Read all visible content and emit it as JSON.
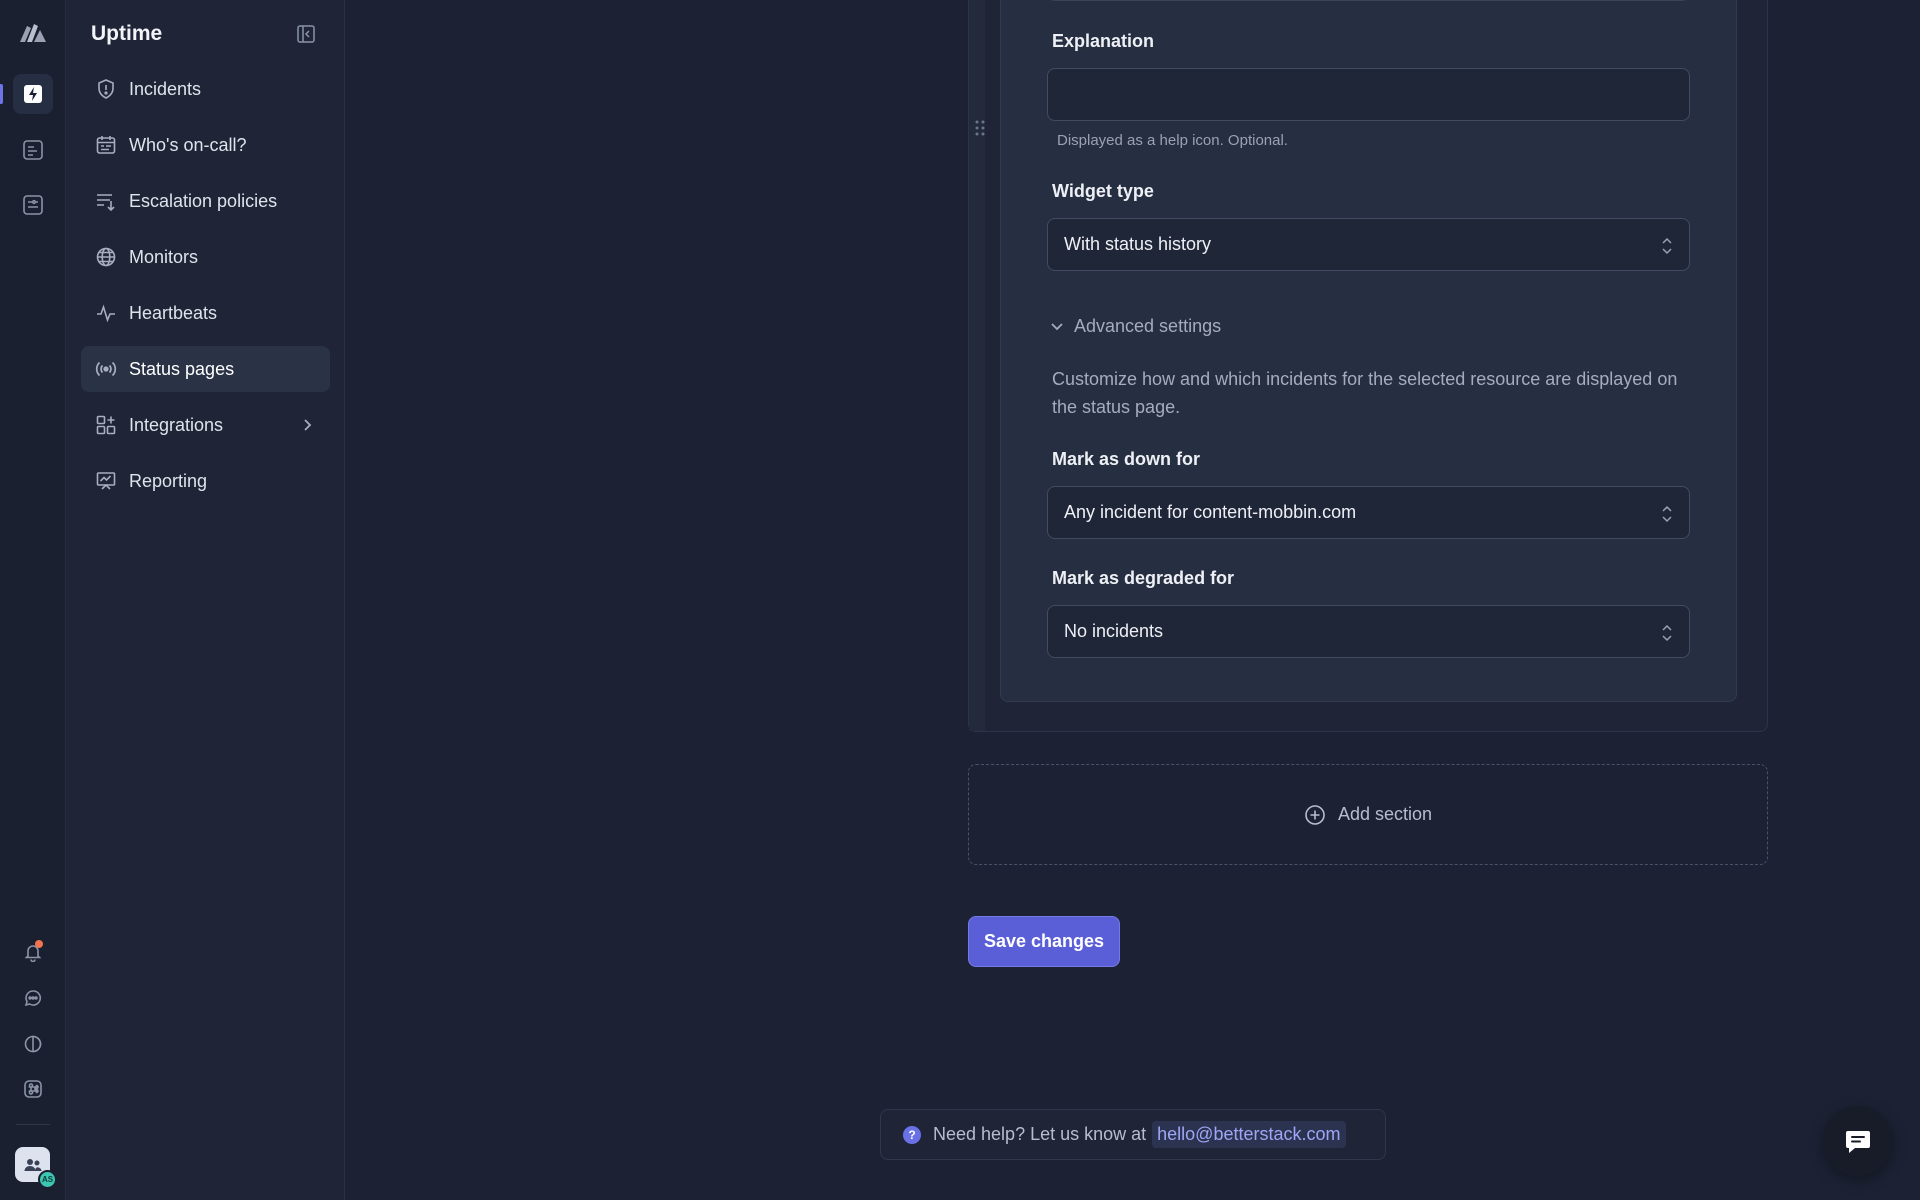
{
  "sidebar": {
    "title": "Uptime",
    "items": [
      {
        "label": "Incidents",
        "icon": "shield-alert-icon"
      },
      {
        "label": "Who's on-call?",
        "icon": "calendar-icon"
      },
      {
        "label": "Escalation policies",
        "icon": "escalation-list-icon"
      },
      {
        "label": "Monitors",
        "icon": "globe-icon"
      },
      {
        "label": "Heartbeats",
        "icon": "pulse-icon"
      },
      {
        "label": "Status pages",
        "icon": "broadcast-icon",
        "active": true
      },
      {
        "label": "Integrations",
        "icon": "grid-plus-icon",
        "has_submenu": true
      },
      {
        "label": "Reporting",
        "icon": "chart-board-icon"
      }
    ]
  },
  "form": {
    "explanation": {
      "label": "Explanation",
      "value": "",
      "hint": "Displayed as a help icon. Optional."
    },
    "widget_type": {
      "label": "Widget type",
      "value": "With status history"
    },
    "advanced": {
      "toggle_label": "Advanced settings",
      "description": "Customize how and which incidents for the selected resource are displayed on the status page."
    },
    "mark_down": {
      "label": "Mark as down for",
      "value": "Any incident for content-mobbin.com"
    },
    "mark_degraded": {
      "label": "Mark as degraded for",
      "value": "No incidents"
    }
  },
  "add_section_label": "Add section",
  "save_label": "Save changes",
  "help": {
    "text": "Need help? Let us know at",
    "email": "hello@betterstack.com"
  },
  "user": {
    "initials": "AS"
  },
  "colors": {
    "accent": "#5a5fd8",
    "background": "#1c2234",
    "notification": "#f0744f"
  }
}
